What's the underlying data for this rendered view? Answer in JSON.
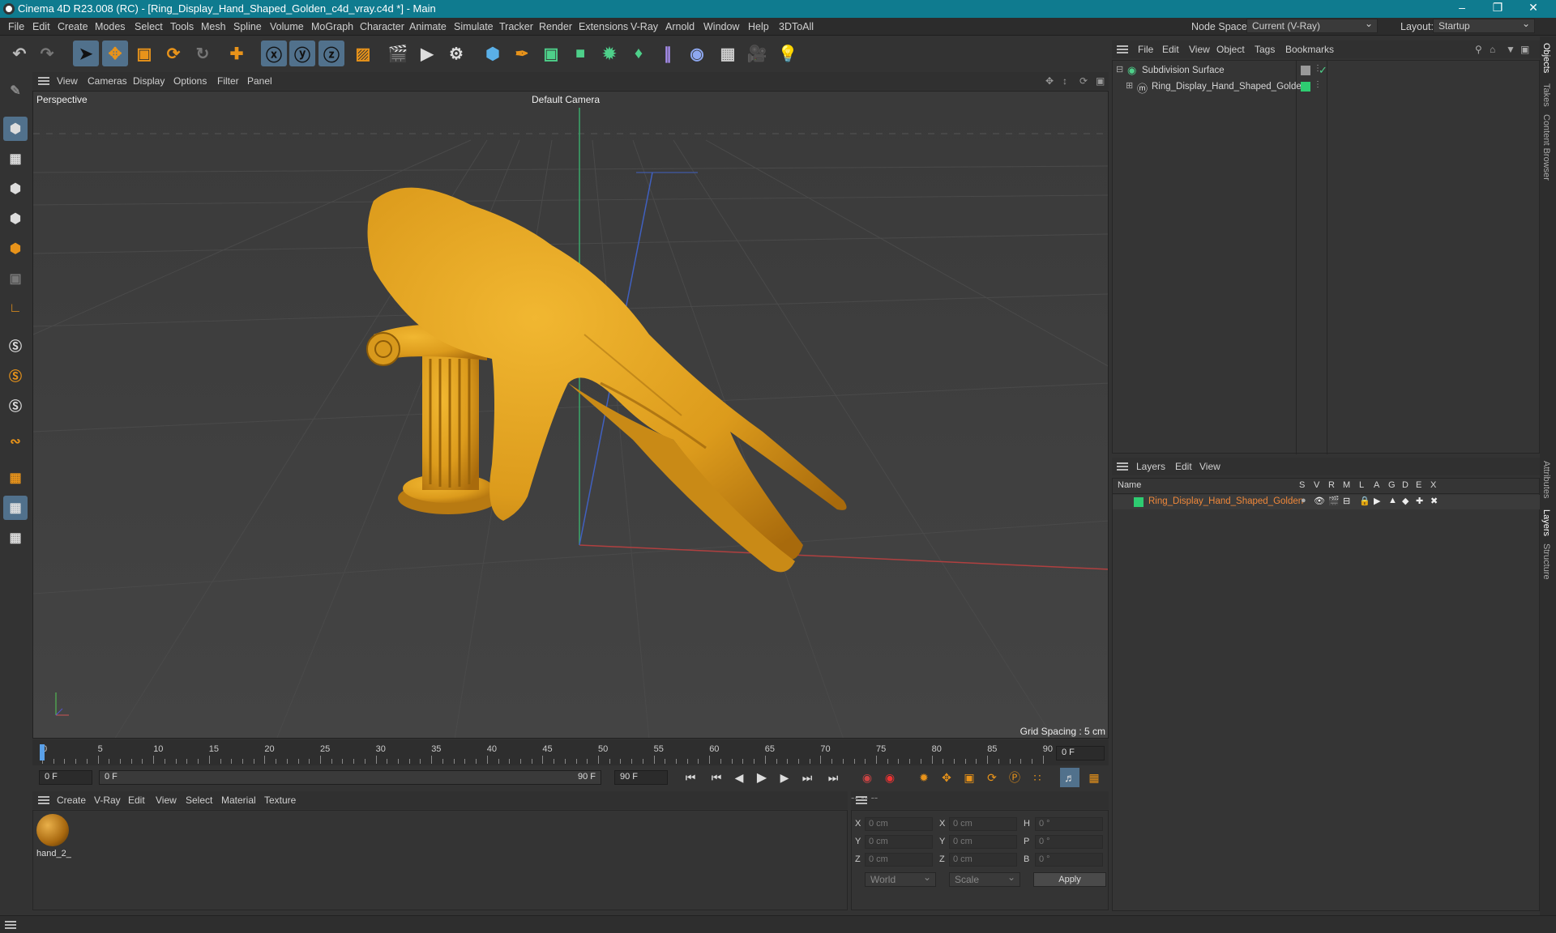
{
  "window": {
    "title": "Cinema 4D R23.008 (RC) - [Ring_Display_Hand_Shaped_Golden_c4d_vray.c4d *] - Main"
  },
  "menubar": {
    "items": [
      "File",
      "Edit",
      "Create",
      "Modes",
      "Select",
      "Tools",
      "Mesh",
      "Spline",
      "Volume",
      "MoGraph",
      "Character",
      "Animate",
      "Simulate",
      "Tracker",
      "Render",
      "Extensions",
      "V-Ray",
      "Arnold",
      "Window",
      "Help",
      "3DToAll"
    ],
    "node_space_label": "Node Space:",
    "node_space_value": "Current (V-Ray)",
    "layout_label": "Layout:",
    "layout_value": "Startup"
  },
  "viewport": {
    "menu": [
      "View",
      "Cameras",
      "Display",
      "Options",
      "Filter",
      "Panel"
    ],
    "label": "Perspective",
    "camera": "Default Camera",
    "grid_spacing": "Grid Spacing : 5 cm"
  },
  "timeline": {
    "ticks": [
      "0",
      "5",
      "10",
      "15",
      "20",
      "25",
      "30",
      "35",
      "40",
      "45",
      "50",
      "55",
      "60",
      "65",
      "70",
      "75",
      "80",
      "85",
      "90"
    ],
    "current_frame": "0 F",
    "start_field": "0 F",
    "range_start": "0 F",
    "range_end": "90 F",
    "end_field": "90 F"
  },
  "material_manager": {
    "menu": [
      "Create",
      "V-Ray",
      "Edit",
      "View",
      "Select",
      "Material",
      "Texture"
    ],
    "materials": [
      {
        "name": "hand_2_"
      }
    ]
  },
  "coordinates": {
    "headers": [
      "--",
      "--",
      "--"
    ],
    "rows": [
      {
        "a": "X",
        "v1": "0 cm",
        "b": "X",
        "v2": "0 cm",
        "c": "H",
        "v3": "0 °"
      },
      {
        "a": "Y",
        "v1": "0 cm",
        "b": "Y",
        "v2": "0 cm",
        "c": "P",
        "v3": "0 °"
      },
      {
        "a": "Z",
        "v1": "0 cm",
        "b": "Z",
        "v2": "0 cm",
        "c": "B",
        "v3": "0 °"
      }
    ],
    "mode_world": "World",
    "mode_scale": "Scale",
    "apply": "Apply"
  },
  "object_manager": {
    "menu": [
      "File",
      "Edit",
      "View",
      "Object",
      "Tags",
      "Bookmarks"
    ],
    "objects": [
      {
        "name": "Subdivision Surface"
      },
      {
        "name": "Ring_Display_Hand_Shaped_Golden"
      }
    ]
  },
  "layer_manager": {
    "menu": [
      "Layers",
      "Edit",
      "View"
    ],
    "columns": [
      "Name",
      "S",
      "V",
      "R",
      "M",
      "L",
      "A",
      "G",
      "D",
      "E",
      "X"
    ],
    "layers": [
      {
        "name": "Ring_Display_Hand_Shaped_Golden",
        "color": "#2ecc71"
      }
    ]
  },
  "side_tabs": [
    "Objects",
    "Takes",
    "Content Browser",
    "Attributes",
    "Layers",
    "Structure"
  ],
  "colors": {
    "accent_title": "#0f7b8f",
    "gold": "#e3a21a",
    "layer_text": "#f0883a",
    "active_tool": "#51718c"
  }
}
